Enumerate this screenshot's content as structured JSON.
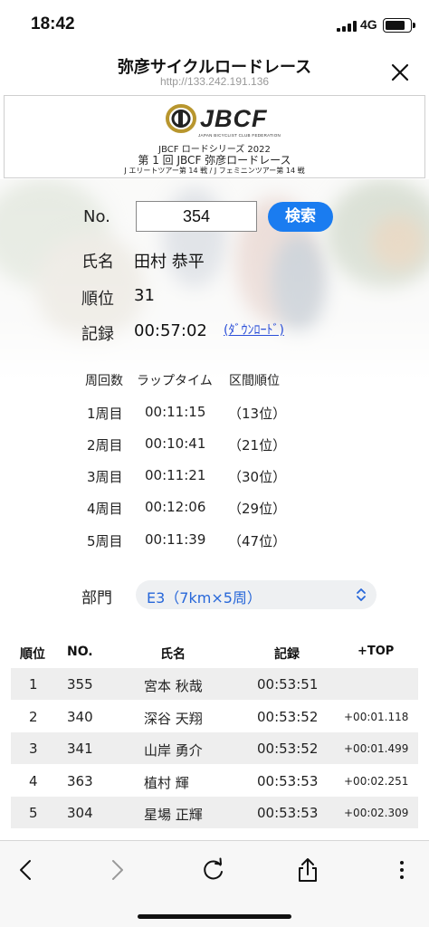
{
  "status_bar": {
    "time": "18:42",
    "network": "4G",
    "signal_bars": 4,
    "battery_level": 0.85
  },
  "browser": {
    "title": "弥彦サイクルロードレース",
    "url": "http://133.242.191.136"
  },
  "banner": {
    "logo": "JBCF",
    "logo_sub": "JAPAN BICYCLIST CLUB FEDERATION",
    "line1": "JBCF ロードシリーズ 2022",
    "line2": "第 1 回  JBCF 弥彦ロードレース",
    "line3": "J エリートツアー第 14 戦  /  J フェミニンツアー第 14 戦"
  },
  "form": {
    "no_label": "No.",
    "no_value": "354",
    "search_button": "検索"
  },
  "rider": {
    "name_label": "氏名",
    "name": "田村 恭平",
    "rank_label": "順位",
    "rank": "31",
    "record_label": "記録",
    "record": "00:57:02",
    "download": "(ﾀﾞｳﾝﾛｰﾄﾞ)"
  },
  "laps": {
    "headers": [
      "周回数",
      "ラップタイム",
      "区間順位"
    ],
    "rows": [
      {
        "lap": "1周目",
        "time": "00:11:15",
        "rank": "（13位）"
      },
      {
        "lap": "2周目",
        "time": "00:10:41",
        "rank": "（21位）"
      },
      {
        "lap": "3周目",
        "time": "00:11:21",
        "rank": "（30位）"
      },
      {
        "lap": "4周目",
        "time": "00:12:06",
        "rank": "（29位）"
      },
      {
        "lap": "5周目",
        "time": "00:11:39",
        "rank": "（47位）"
      }
    ]
  },
  "category": {
    "label": "部門",
    "selected": "E3（7km×5周）"
  },
  "results": {
    "headers": [
      "順位",
      "NO.",
      "氏名",
      "記録",
      "+TOP"
    ],
    "rows": [
      {
        "rank": "1",
        "no": "355",
        "name": "宮本 秋哉",
        "record": "00:53:51",
        "gap": ""
      },
      {
        "rank": "2",
        "no": "340",
        "name": "深谷 天翔",
        "record": "00:53:52",
        "gap": "+00:01.118"
      },
      {
        "rank": "3",
        "no": "341",
        "name": "山岸 勇介",
        "record": "00:53:52",
        "gap": "+00:01.499"
      },
      {
        "rank": "4",
        "no": "363",
        "name": "植村 輝",
        "record": "00:53:53",
        "gap": "+00:02.251"
      },
      {
        "rank": "5",
        "no": "304",
        "name": "星場 正輝",
        "record": "00:53:53",
        "gap": "+00:02.309"
      }
    ]
  },
  "icons": {
    "close": "close-icon",
    "back": "chevron-left-icon",
    "forward": "chevron-right-icon",
    "reload": "reload-icon",
    "share": "share-icon",
    "more": "more-vertical-icon"
  },
  "colors": {
    "accent": "#1a7cf0",
    "link": "#2b4fd8",
    "select_text": "#2767d9",
    "logo_gold": "#b8962e"
  }
}
